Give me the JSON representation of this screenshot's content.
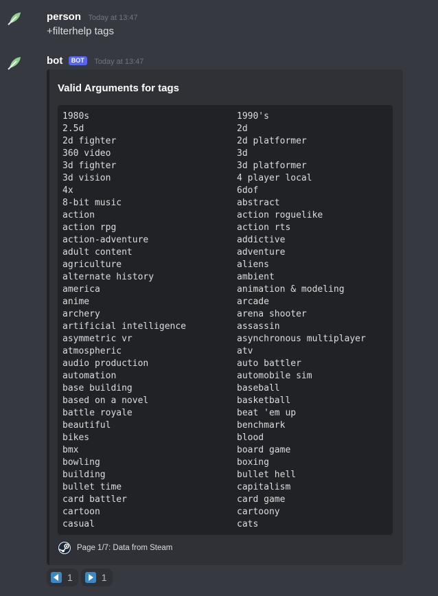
{
  "messages": [
    {
      "username": "person",
      "timestamp": "Today at 13:47",
      "content": "+filterhelp tags"
    },
    {
      "username": "bot",
      "bot_tag": "BOT",
      "timestamp": "Today at 13:47",
      "embed": {
        "title": "Valid Arguments for tags",
        "tags_left": [
          "1980s",
          "2.5d",
          "2d fighter",
          "360 video",
          "3d fighter",
          "3d vision",
          "4x",
          "8-bit music",
          "action",
          "action rpg",
          "action-adventure",
          "adult content",
          "agriculture",
          "alternate history",
          "america",
          "anime",
          "archery",
          "artificial intelligence",
          "asymmetric vr",
          "atmospheric",
          "audio production",
          "automation",
          "base building",
          "based on a novel",
          "battle royale",
          "beautiful",
          "bikes",
          "bmx",
          "bowling",
          "building",
          "bullet time",
          "card battler",
          "cartoon",
          "casual"
        ],
        "tags_right": [
          "1990's",
          "2d",
          "2d platformer",
          "3d",
          "3d platformer",
          "4 player local",
          "6dof",
          "abstract",
          "action roguelike",
          "action rts",
          "addictive",
          "adventure",
          "aliens",
          "ambient",
          "animation & modeling",
          "arcade",
          "arena shooter",
          "assassin",
          "asynchronous multiplayer",
          "atv",
          "auto battler",
          "automobile sim",
          "baseball",
          "basketball",
          "beat 'em up",
          "benchmark",
          "blood",
          "board game",
          "boxing",
          "bullet hell",
          "capitalism",
          "card game",
          "cartoony",
          "cats"
        ],
        "footer_text": "Page 1/7: Data from Steam",
        "footer_icon": "steam-icon"
      },
      "reactions": [
        {
          "emoji": "arrow-backward-icon",
          "count": "1"
        },
        {
          "emoji": "arrow-forward-icon",
          "count": "1"
        }
      ]
    }
  ]
}
